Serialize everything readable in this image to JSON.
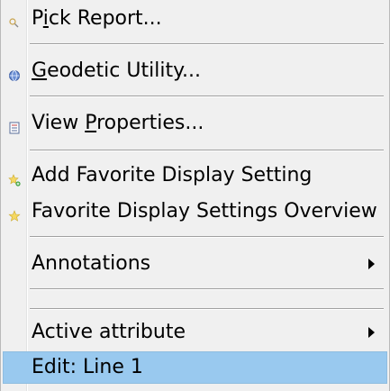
{
  "menu": {
    "items": [
      {
        "label": "Pick Report...",
        "access": "i",
        "icon": "pick-report-icon",
        "has_submenu": false
      },
      {
        "label": "Geodetic Utility...",
        "access": "G",
        "icon": "globe-icon",
        "has_submenu": false
      },
      {
        "label": "View Properties...",
        "access": "P",
        "icon": "properties-icon",
        "has_submenu": false
      },
      {
        "label": "Add Favorite Display Setting",
        "icon": "add-favorite-star-icon",
        "has_submenu": false
      },
      {
        "label": "Favorite Display Settings Overview",
        "icon": "favorite-star-icon",
        "has_submenu": false
      },
      {
        "label": "Annotations",
        "icon": "",
        "has_submenu": true
      },
      {
        "label": "Active attribute",
        "icon": "",
        "has_submenu": true
      },
      {
        "label": "Edit: Line 1",
        "icon": "",
        "has_submenu": false,
        "selected": true
      }
    ]
  },
  "colors": {
    "menu_background": "#f0f0f0",
    "highlight": "#99c9ef",
    "separator": "#a0a0a0"
  }
}
